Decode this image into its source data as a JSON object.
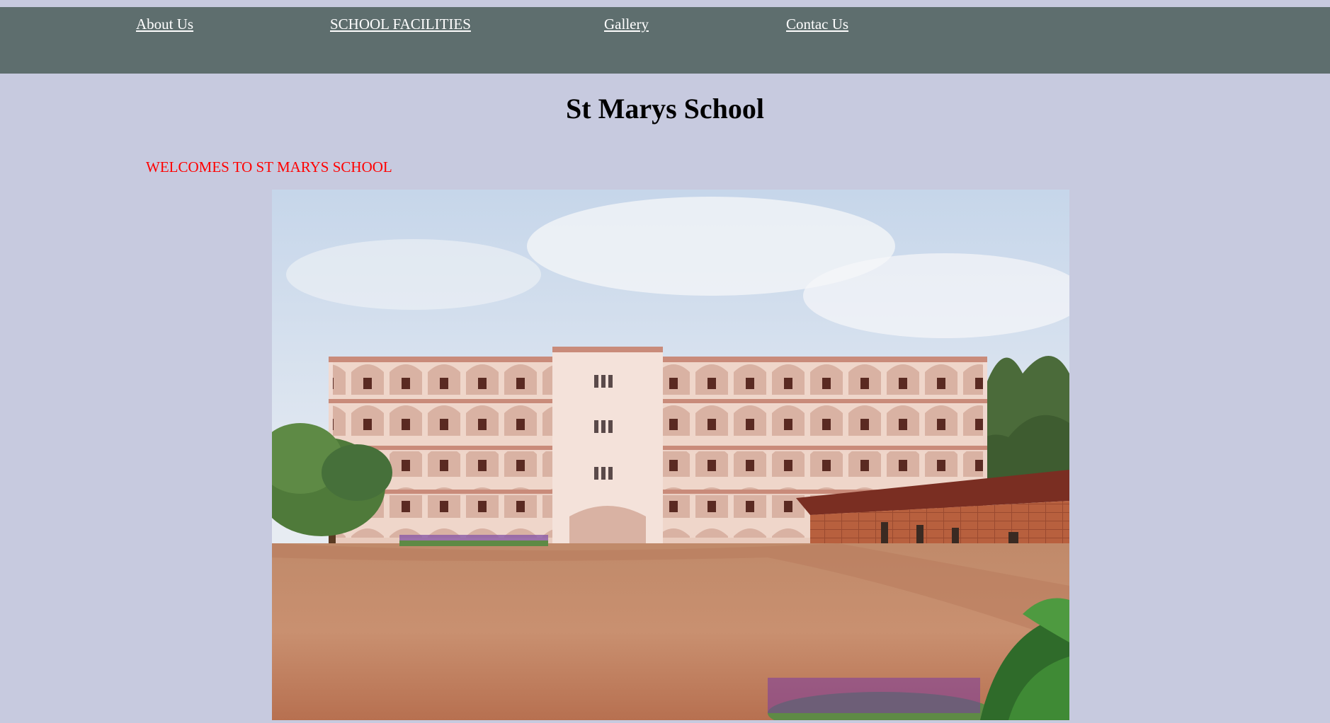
{
  "nav": {
    "items": [
      {
        "label": "About Us"
      },
      {
        "label": "SCHOOL FACILITIES"
      },
      {
        "label": "Gallery"
      },
      {
        "label": "Contac Us"
      }
    ]
  },
  "header": {
    "title": "St Marys School"
  },
  "main": {
    "welcome": "WELCOMES TO ST MARYS SCHOOL"
  },
  "colors": {
    "page_background": "#c7cadf",
    "nav_background": "#5e6e6e",
    "nav_link": "#ffffff",
    "welcome_text": "#ff0000"
  }
}
